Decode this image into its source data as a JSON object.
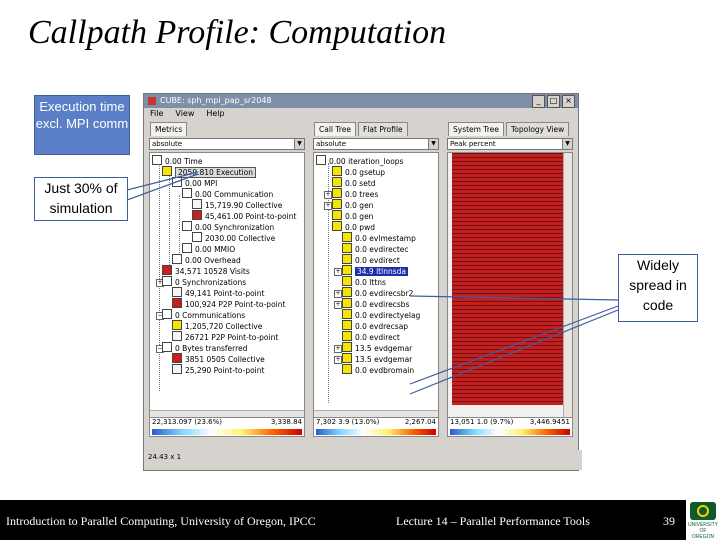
{
  "slide": {
    "title": "Callpath Profile: Computation",
    "callouts": {
      "execution": "Execution time excl. MPI comm",
      "simulation": "Just 30% of simulation",
      "spread": "Widely spread in code"
    }
  },
  "window": {
    "title": "CUBE: sph_mpi_pap_sr2048",
    "controls": [
      "_",
      "□",
      "×"
    ],
    "menu": [
      "File",
      "View",
      "Help"
    ],
    "left": {
      "tabs": [
        "Metrics"
      ],
      "combo": "absolute",
      "rows": [
        {
          "text": "0.00 Time"
        },
        {
          "text": "2059.810 Execution"
        },
        {
          "text": "0.00 MPI"
        },
        {
          "text": "0.00 Communication"
        },
        {
          "text": "15,719.90 Collective"
        },
        {
          "text": "45,461.00 Point-to-point"
        },
        {
          "text": "0.00 Synchronization"
        },
        {
          "text": "2030.00 Collective"
        },
        {
          "text": "0.00 MMIO"
        },
        {
          "text": "0.00 Overhead"
        },
        {
          "text": "34,571 10528 Visits"
        },
        {
          "text": "0 Synchronizations"
        },
        {
          "text": "49,141 Point-to-point"
        },
        {
          "text": "100,924 P2P Point-to-point"
        },
        {
          "text": "0 Communications"
        },
        {
          "text": "1,205,720 Collective"
        },
        {
          "text": "26721 P2P Point-to-point"
        },
        {
          "text": "0 Bytes transferred"
        },
        {
          "text": "3851 0505 Collective"
        },
        {
          "text": "25,290 Point-to-point"
        }
      ],
      "bottom_left": "22,313.097 (23.6%)",
      "bottom_right": "3,338.84"
    },
    "middle": {
      "tabs": [
        "Call Tree",
        "Flat Profile"
      ],
      "combo": "absolute",
      "rows": [
        {
          "text": "0.00 iteration_loops"
        },
        {
          "text": "0.0 gsetup"
        },
        {
          "text": "0.0 setd"
        },
        {
          "text": "0.0 trees"
        },
        {
          "text": "0.0 gen"
        },
        {
          "text": "0.0 gen"
        },
        {
          "text": "0.0 pwd"
        },
        {
          "text": "0.0 evlmestamp"
        },
        {
          "text": "0.0 evdirectec"
        },
        {
          "text": "0.0 evdirect"
        },
        {
          "text": "34.9 ltlnnsda"
        },
        {
          "text": "0.0 lttns"
        },
        {
          "text": "0.0 evdirecsbr2"
        },
        {
          "text": "0.0 evdirecsbs"
        },
        {
          "text": "0.0 evdirectyelag"
        },
        {
          "text": "0.0 evdrecsap"
        },
        {
          "text": "0.0 evdirect"
        },
        {
          "text": "13.5 evdgemar"
        },
        {
          "text": "13.5 evdgemar"
        },
        {
          "text": "0.0 evdbromain"
        }
      ],
      "bottom_left": "7,302 3.9 (13.0%)",
      "bottom_right": "2,267.04"
    },
    "right": {
      "tabs": [
        "System Tree",
        "Topology View"
      ],
      "combo": "Peak percent",
      "bottom_left": "13,051 1.0 (9.7%)",
      "bottom_right": "3,446.9451"
    },
    "status": "24.43 x 1"
  },
  "footer": {
    "left": "Introduction to Parallel Computing, University of Oregon, IPCC",
    "center": "Lecture 14 – Parallel Performance Tools",
    "page": "39",
    "logo_text": "UNIVERSITY OF OREGON"
  },
  "colors": {
    "callout_blue": "#5b7fc7",
    "select_blue": "#1a2fa8",
    "heat_red": "#c22020",
    "footer_black": "#000000",
    "oregon_green": "#0f5a2a",
    "oregon_yellow": "#f2d200"
  }
}
